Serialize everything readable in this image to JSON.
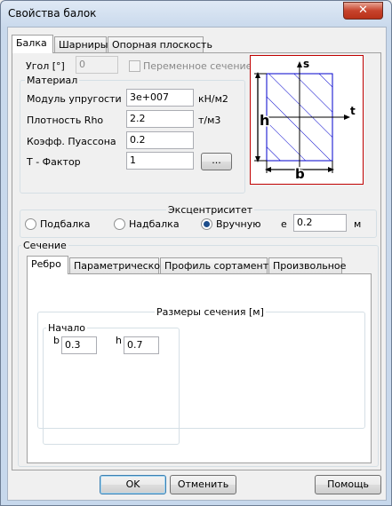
{
  "window": {
    "title": "Свойства балок",
    "close_glyph": "✕"
  },
  "tabs": [
    "Балка",
    "Шарниры",
    "Опорная плоскость"
  ],
  "angle": {
    "label": "Угол [°]",
    "value": "0",
    "variable_label": "Переменное сечение"
  },
  "material": {
    "title": "Материал",
    "rows": [
      {
        "label": "Модуль упругости",
        "value": "3e+007",
        "unit": "кН/м2"
      },
      {
        "label": "Плотность Rho",
        "value": "2.2",
        "unit": "т/м3"
      },
      {
        "label": "Коэфф. Пуассона",
        "value": "0.2",
        "unit": ""
      },
      {
        "label": "T - Фактор",
        "value": "1",
        "unit": ""
      }
    ],
    "browse_label": "..."
  },
  "diagram": {
    "s": "s",
    "t": "t",
    "h": "h",
    "b": "b",
    "colors": {
      "border": "#c00000",
      "section": "#0000cc"
    }
  },
  "eccentricity": {
    "title": "Эксцентриситет",
    "options": [
      "Подбалка",
      "Надбалка",
      "Вручную"
    ],
    "selected": "Вручную",
    "e_label": "e",
    "e_value": "0.2",
    "unit": "м"
  },
  "section": {
    "title": "Сечение",
    "tabs": [
      "Ребро",
      "Параметрическое",
      "Профиль сортамента",
      "Произвольное"
    ],
    "dims_title": "Размеры сечения [м]",
    "start_title": "Начало",
    "b_label": "b",
    "b_value": "0.3",
    "h_label": "h",
    "h_value": "0.7"
  },
  "buttons": {
    "ok": "OK",
    "cancel": "Отменить",
    "help": "Помощь"
  }
}
